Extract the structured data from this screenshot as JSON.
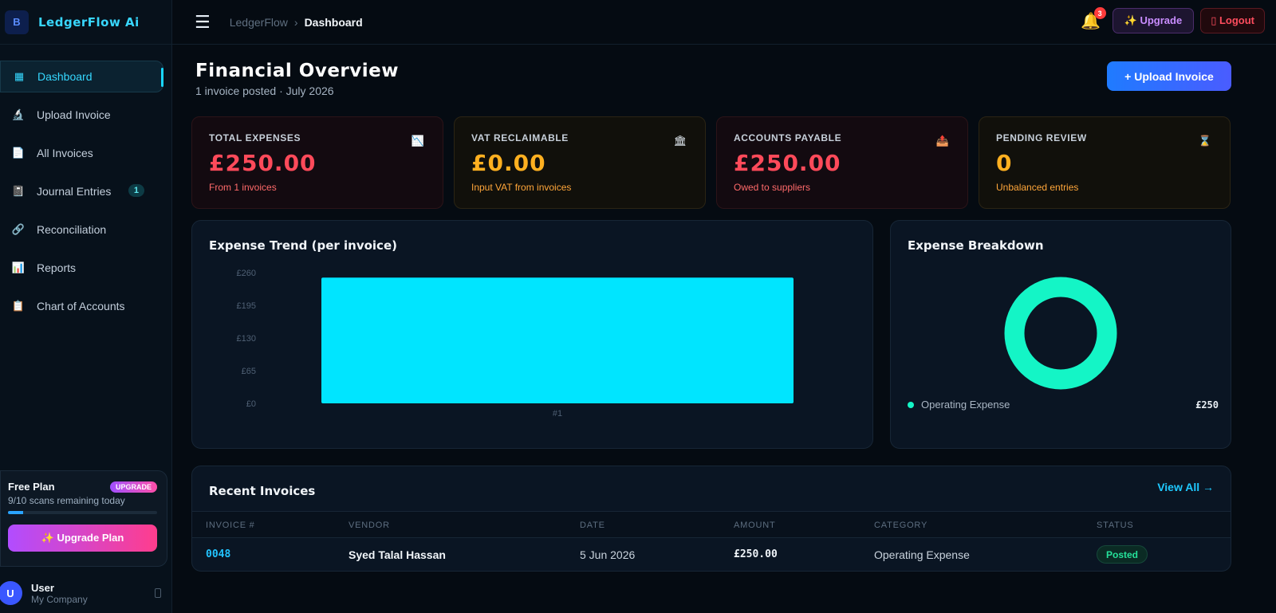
{
  "app": {
    "name": "LedgerFlow Ai",
    "logo_text": "B"
  },
  "sidebar": {
    "items": [
      {
        "label": "Dashboard",
        "icon": "grid-icon",
        "glyph": "▦"
      },
      {
        "label": "Upload Invoice",
        "icon": "microscope-icon",
        "glyph": "🔬"
      },
      {
        "label": "All Invoices",
        "icon": "document-icon",
        "glyph": "📄"
      },
      {
        "label": "Journal Entries",
        "icon": "notebook-icon",
        "glyph": "📓",
        "badge": "1"
      },
      {
        "label": "Reconciliation",
        "icon": "link-icon",
        "glyph": "🔗"
      },
      {
        "label": "Reports",
        "icon": "bar-chart-icon",
        "glyph": "📊"
      },
      {
        "label": "Chart of Accounts",
        "icon": "clipboard-icon",
        "glyph": "📋"
      }
    ],
    "plan": {
      "title": "Free Plan",
      "badge": "UPGRADE",
      "usage_text": "9/10 scans remaining today",
      "usage_fraction": 0.1,
      "button_label": "✨ Upgrade Plan"
    },
    "user": {
      "initial": "U",
      "name": "User",
      "company": "My Company"
    }
  },
  "topbar": {
    "menu_glyph": "☰",
    "breadcrumb": {
      "root": "LedgerFlow",
      "separator": "›",
      "current": "Dashboard"
    },
    "notifications": {
      "count": "3",
      "glyph": "🔔"
    },
    "upgrade_label": "✨ Upgrade",
    "logout_label": "▯ Logout"
  },
  "header": {
    "title": "Financial Overview",
    "subtitle": "1 invoice posted · July 2026",
    "primary_button": "+ Upload Invoice"
  },
  "stats": [
    {
      "label": "TOTAL EXPENSES",
      "value": "£250.00",
      "desc": "From 1 invoices",
      "icon": "trend-down-icon",
      "glyph": "📉"
    },
    {
      "label": "VAT RECLAIMABLE",
      "value": "£0.00",
      "desc": "Input VAT from invoices",
      "icon": "bank-icon",
      "glyph": "🏛"
    },
    {
      "label": "ACCOUNTS PAYABLE",
      "value": "£250.00",
      "desc": "Owed to suppliers",
      "icon": "outbox-icon",
      "glyph": "📤"
    },
    {
      "label": "PENDING REVIEW",
      "value": "0",
      "desc": "Unbalanced entries",
      "icon": "hourglass-icon",
      "glyph": "⌛"
    }
  ],
  "chart_data": [
    {
      "type": "bar",
      "title": "Expense Trend (per invoice)",
      "categories": [
        "#1"
      ],
      "values": [
        250
      ],
      "ylim": [
        0,
        260
      ],
      "yticks": [
        0,
        65,
        130,
        195,
        260
      ],
      "ytick_labels": [
        "£0",
        "£65",
        "£130",
        "£195",
        "£260"
      ],
      "xlabel": "",
      "ylabel": "",
      "grid": false,
      "color": "#00e5ff"
    },
    {
      "type": "pie",
      "title": "Expense Breakdown",
      "donut": true,
      "labels": [
        "Operating Expense"
      ],
      "values": [
        250
      ],
      "value_labels": [
        "£250"
      ],
      "colors": [
        "#14f5c6"
      ]
    }
  ],
  "recent": {
    "title": "Recent Invoices",
    "view_all": "View All →",
    "columns": [
      "INVOICE #",
      "VENDOR",
      "DATE",
      "AMOUNT",
      "CATEGORY",
      "STATUS"
    ],
    "rows": [
      {
        "invoice": "0048",
        "vendor": "Syed Talal Hassan",
        "date": "5 Jun 2026",
        "amount": "£250.00",
        "category": "Operating Expense",
        "status": "Posted"
      }
    ]
  },
  "colors": {
    "accent": "#19d6ff",
    "expense": "#ff4a5a",
    "warning": "#ffb020",
    "success": "#25e29a"
  }
}
